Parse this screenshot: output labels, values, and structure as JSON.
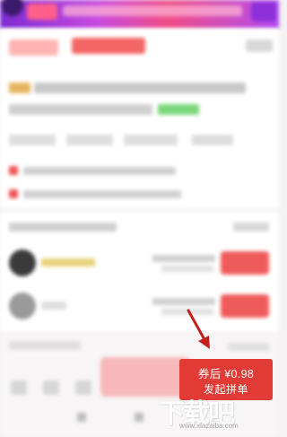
{
  "purchase_button": {
    "price_line": "券后 ¥0.98",
    "action_line": "发起拼单"
  },
  "watermark": {
    "brand": "下载吧",
    "url": "www.xiazaiba.com"
  },
  "colors": {
    "accent": "#e23a35",
    "arrow": "#c2201d",
    "banner_start": "#7c2bd3",
    "banner_end": "#ef4e86"
  },
  "icons": {
    "annotation": "red-arrow-icon",
    "nav_menu": "menu-icon",
    "nav_home": "home-icon"
  }
}
